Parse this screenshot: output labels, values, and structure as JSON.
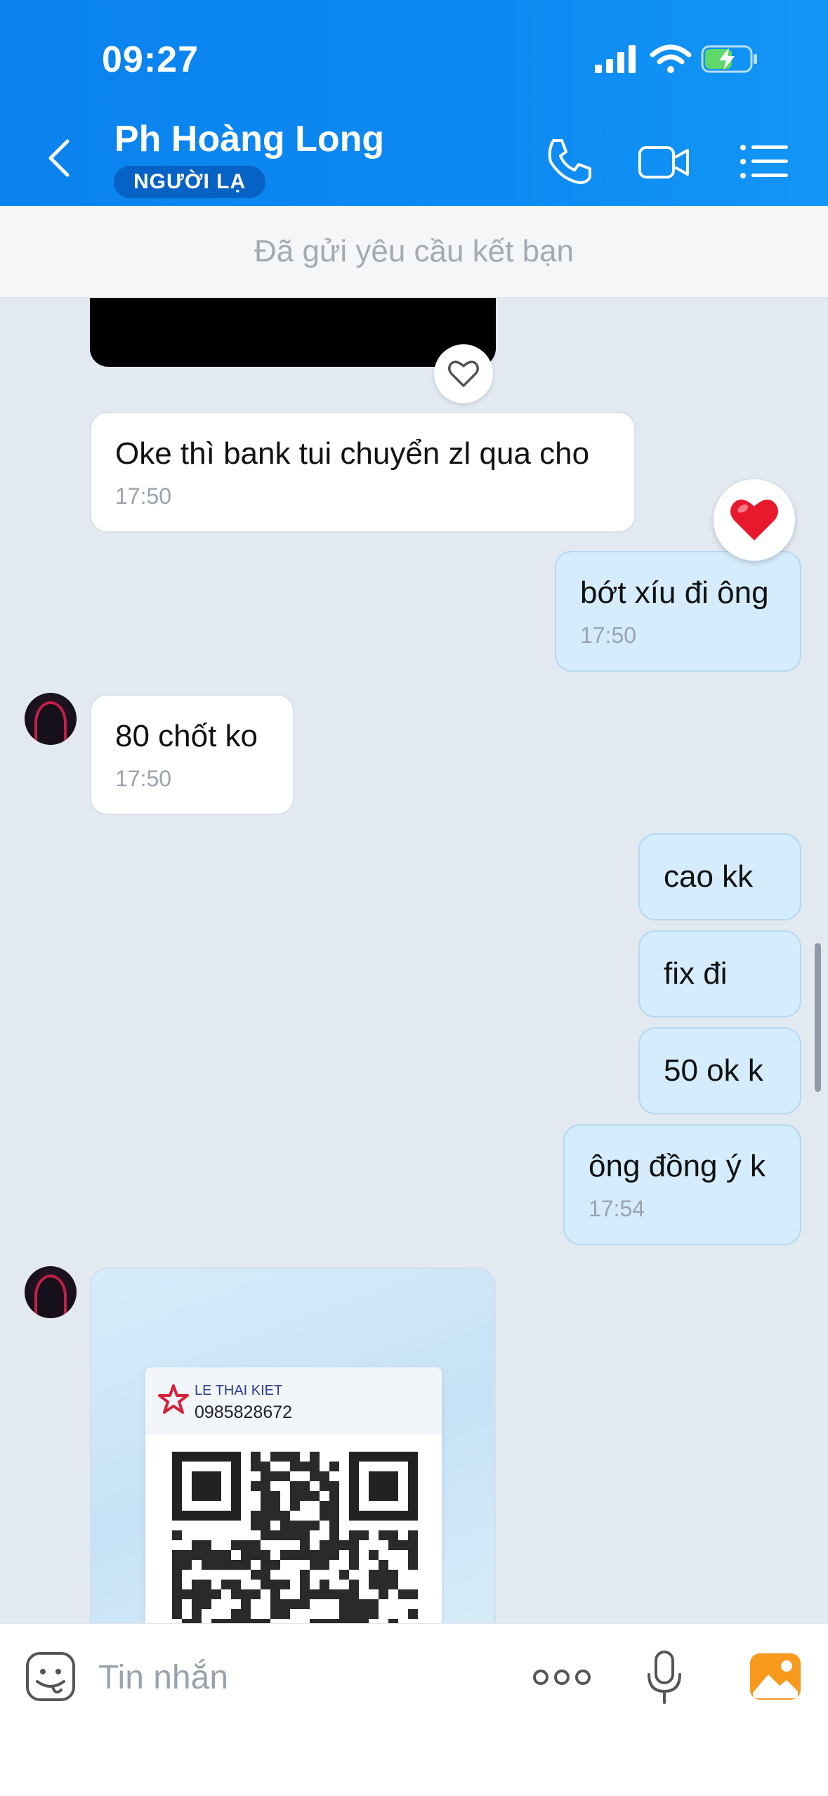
{
  "status_bar": {
    "time": "09:27"
  },
  "header": {
    "contact_name": "Ph Hoàng Long",
    "badge": "NGƯỜI LẠ",
    "accent_color": "#0a82ee"
  },
  "notice": {
    "text": "Đã gửi yêu cầu kết bạn"
  },
  "messages": [
    {
      "direction": "in",
      "text": "Oke thì bank tui chuyển zl qua cho",
      "time": "17:50"
    },
    {
      "direction": "out",
      "text": "bớt xíu đi ông",
      "time": "17:50",
      "reaction": "heart"
    },
    {
      "direction": "in",
      "text": "80 chốt ko",
      "time": "17:50"
    },
    {
      "direction": "out",
      "text": "cao kk"
    },
    {
      "direction": "out",
      "text": "fix đi"
    },
    {
      "direction": "out",
      "text": "50 ok k"
    },
    {
      "direction": "out",
      "text": "ông đồng ý k",
      "time": "17:54"
    }
  ],
  "qr_card": {
    "name": "LE THAI KIET",
    "phone": "0985828672"
  },
  "input": {
    "placeholder": "Tin nhắn"
  },
  "icons": {
    "back": "chevron-left-icon",
    "call": "phone-icon",
    "video": "video-camera-icon",
    "menu": "list-menu-icon",
    "sticker": "sticker-face-icon",
    "more": "more-dots-icon",
    "mic": "microphone-icon",
    "photo": "photo-gallery-icon"
  }
}
